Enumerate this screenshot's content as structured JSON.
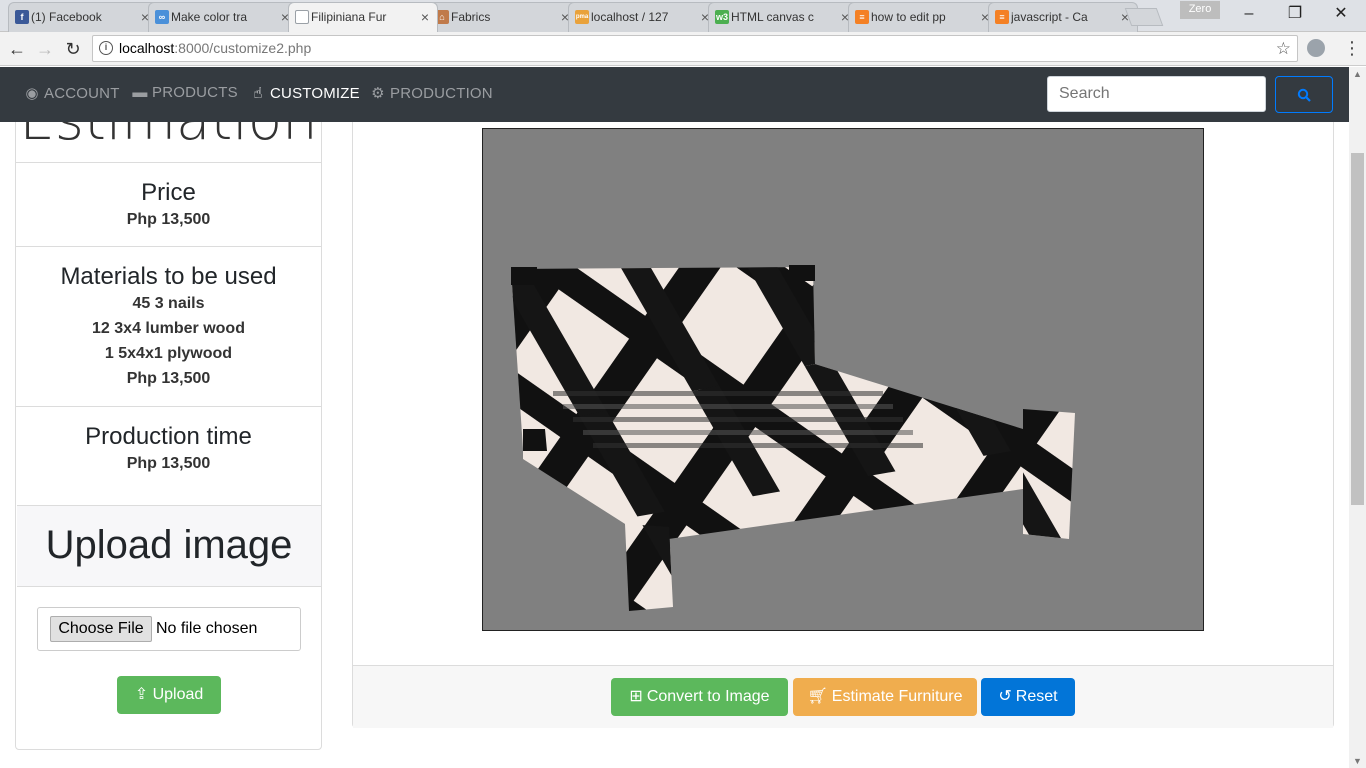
{
  "browser": {
    "tabs": [
      {
        "label": "(1) Facebook",
        "icon": "facebook-icon",
        "color": "#3b5998",
        "glyph": "f"
      },
      {
        "label": "Make color tra",
        "icon": "link-icon",
        "color": "#4a90d9",
        "glyph": "∞"
      },
      {
        "label": "Filipiniana Fur",
        "icon": "page-icon",
        "color": "#9aa0a6",
        "glyph": ""
      },
      {
        "label": "Fabrics",
        "icon": "fabrics-icon",
        "color": "#c07a4a",
        "glyph": "⌂"
      },
      {
        "label": "localhost / 127",
        "icon": "phpmyadmin-icon",
        "color": "#e9a23b",
        "glyph": "pma"
      },
      {
        "label": "HTML canvas c",
        "icon": "w3schools-icon",
        "color": "#4caf50",
        "glyph": "w3"
      },
      {
        "label": "how to edit pp",
        "icon": "stackoverflow-icon",
        "color": "#f48024",
        "glyph": "≡"
      },
      {
        "label": "javascript - Ca",
        "icon": "stackoverflow-icon",
        "color": "#f48024",
        "glyph": "≡"
      }
    ],
    "active_tab_index": 2,
    "profile_name": "Zero",
    "address": {
      "host": "localhost",
      "path": ":8000/customize2.php"
    }
  },
  "navbar": {
    "items": [
      {
        "label": "ACCOUNT",
        "icon": "user-circle-icon"
      },
      {
        "label": "PRODUCTS",
        "icon": "bed-icon"
      },
      {
        "label": "CUSTOMIZE",
        "icon": "hand-pointer-icon"
      },
      {
        "label": "PRODUCTION",
        "icon": "gear-icon"
      }
    ],
    "active": "CUSTOMIZE",
    "search_placeholder": "Search"
  },
  "estimation": {
    "title": "Estimation",
    "price": {
      "heading": "Price",
      "value": "Php 13,500"
    },
    "materials": {
      "heading": "Materials to be used",
      "items": [
        "45 3 nails",
        "12 3x4 lumber wood",
        "1 5x4x1 plywood",
        "Php 13,500"
      ]
    },
    "production_time": {
      "heading": "Production time",
      "value": "Php 13,500"
    }
  },
  "upload": {
    "heading": "Upload image",
    "choose_label": "Choose File",
    "no_file_label": "No file chosen",
    "button_label": "Upload"
  },
  "actions": {
    "convert_label": "Convert to Image",
    "estimate_label": "Estimate Furniture",
    "reset_label": "Reset"
  },
  "colors": {
    "navbar_bg": "#343a40",
    "success": "#5cb85c",
    "warning": "#f0ad4e",
    "primary": "#0275d8",
    "canvas_bg": "#808080"
  }
}
